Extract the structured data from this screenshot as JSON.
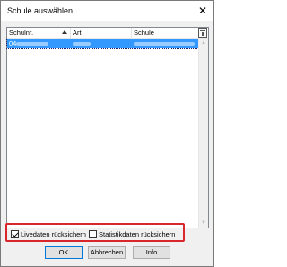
{
  "window": {
    "title": "Schule auswählen",
    "close_glyph": "✕"
  },
  "table": {
    "columns": [
      {
        "label": "Schulnr.",
        "sorted": "ascending"
      },
      {
        "label": "Art"
      },
      {
        "label": "Schule"
      }
    ],
    "rows": [
      {
        "schulnr": "04",
        "art": "",
        "schule": "",
        "selected": true
      }
    ]
  },
  "options": {
    "livedaten": {
      "label": "Livedaten rücksichern",
      "checked": true
    },
    "statistikdaten": {
      "label": "Statistikdaten rücksichern",
      "checked": false
    }
  },
  "buttons": {
    "ok": "OK",
    "cancel": "Abbrechen",
    "info": "Info"
  },
  "colors": {
    "selection": "#3399ff",
    "highlight_box": "#d9262c"
  },
  "icons": {
    "close": "close-icon",
    "column_chooser": "column-chooser-icon",
    "sort": "sort-ascending-icon"
  }
}
